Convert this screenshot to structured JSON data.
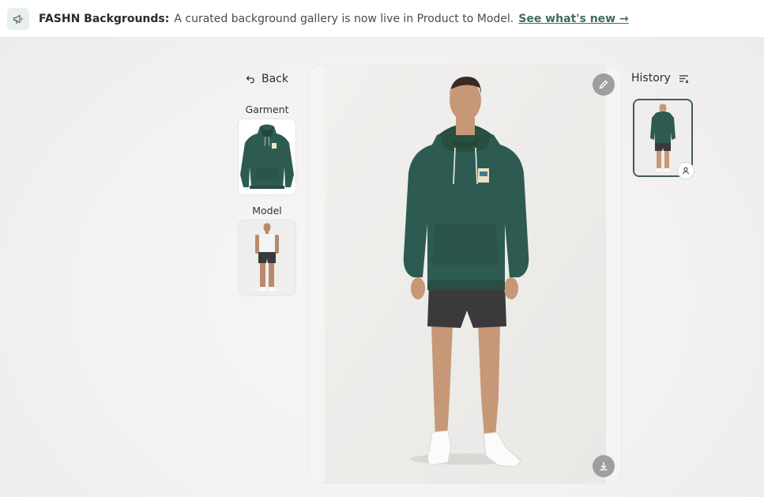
{
  "banner": {
    "icon": "megaphone-icon",
    "title": "FASHN Backgrounds:",
    "text": "A curated background gallery is now live in Product to Model.",
    "link": "See what's new →"
  },
  "sidebar": {
    "back_label": "Back",
    "garment_label": "Garment",
    "model_label": "Model"
  },
  "viewer": {
    "edit_icon": "pencil-icon",
    "download_icon": "download-icon"
  },
  "history": {
    "title": "History",
    "icon": "list-filter-icon",
    "item_badge_icon": "person-icon"
  },
  "colors": {
    "accent": "#3f6b63",
    "hoodie": "#2e5b51",
    "shorts": "#3a3a3d"
  }
}
